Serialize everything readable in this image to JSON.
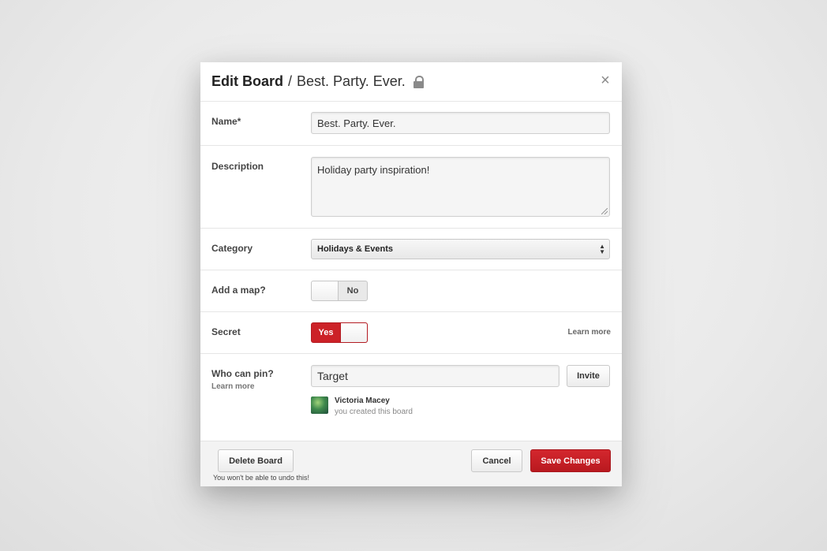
{
  "header": {
    "title": "Edit Board",
    "separator": "/",
    "board_name": "Best. Party. Ever.",
    "lock_icon": "lock-icon",
    "close_label": "×"
  },
  "form": {
    "name": {
      "label": "Name*",
      "value": "Best. Party. Ever."
    },
    "description": {
      "label": "Description",
      "value": "Holiday party inspiration!"
    },
    "category": {
      "label": "Category",
      "selected": "Holidays & Events",
      "arrows": "▲▼"
    },
    "map": {
      "label": "Add a map?",
      "state_label": "No",
      "enabled": false
    },
    "secret": {
      "label": "Secret",
      "state_label": "Yes",
      "enabled": true,
      "learn_more": "Learn more"
    },
    "who_can_pin": {
      "label": "Who can pin?",
      "learn_more": "Learn more",
      "input_value": "Target",
      "invite_label": "Invite",
      "user": {
        "name": "Victoria Macey",
        "subtitle": "you created this board"
      }
    }
  },
  "footer": {
    "delete_label": "Delete Board",
    "delete_note": "You won't be able to undo this!",
    "cancel_label": "Cancel",
    "save_label": "Save Changes"
  },
  "colors": {
    "accent_red": "#cc2127",
    "background": "#e9e9e9",
    "dialog": "#ffffff"
  }
}
